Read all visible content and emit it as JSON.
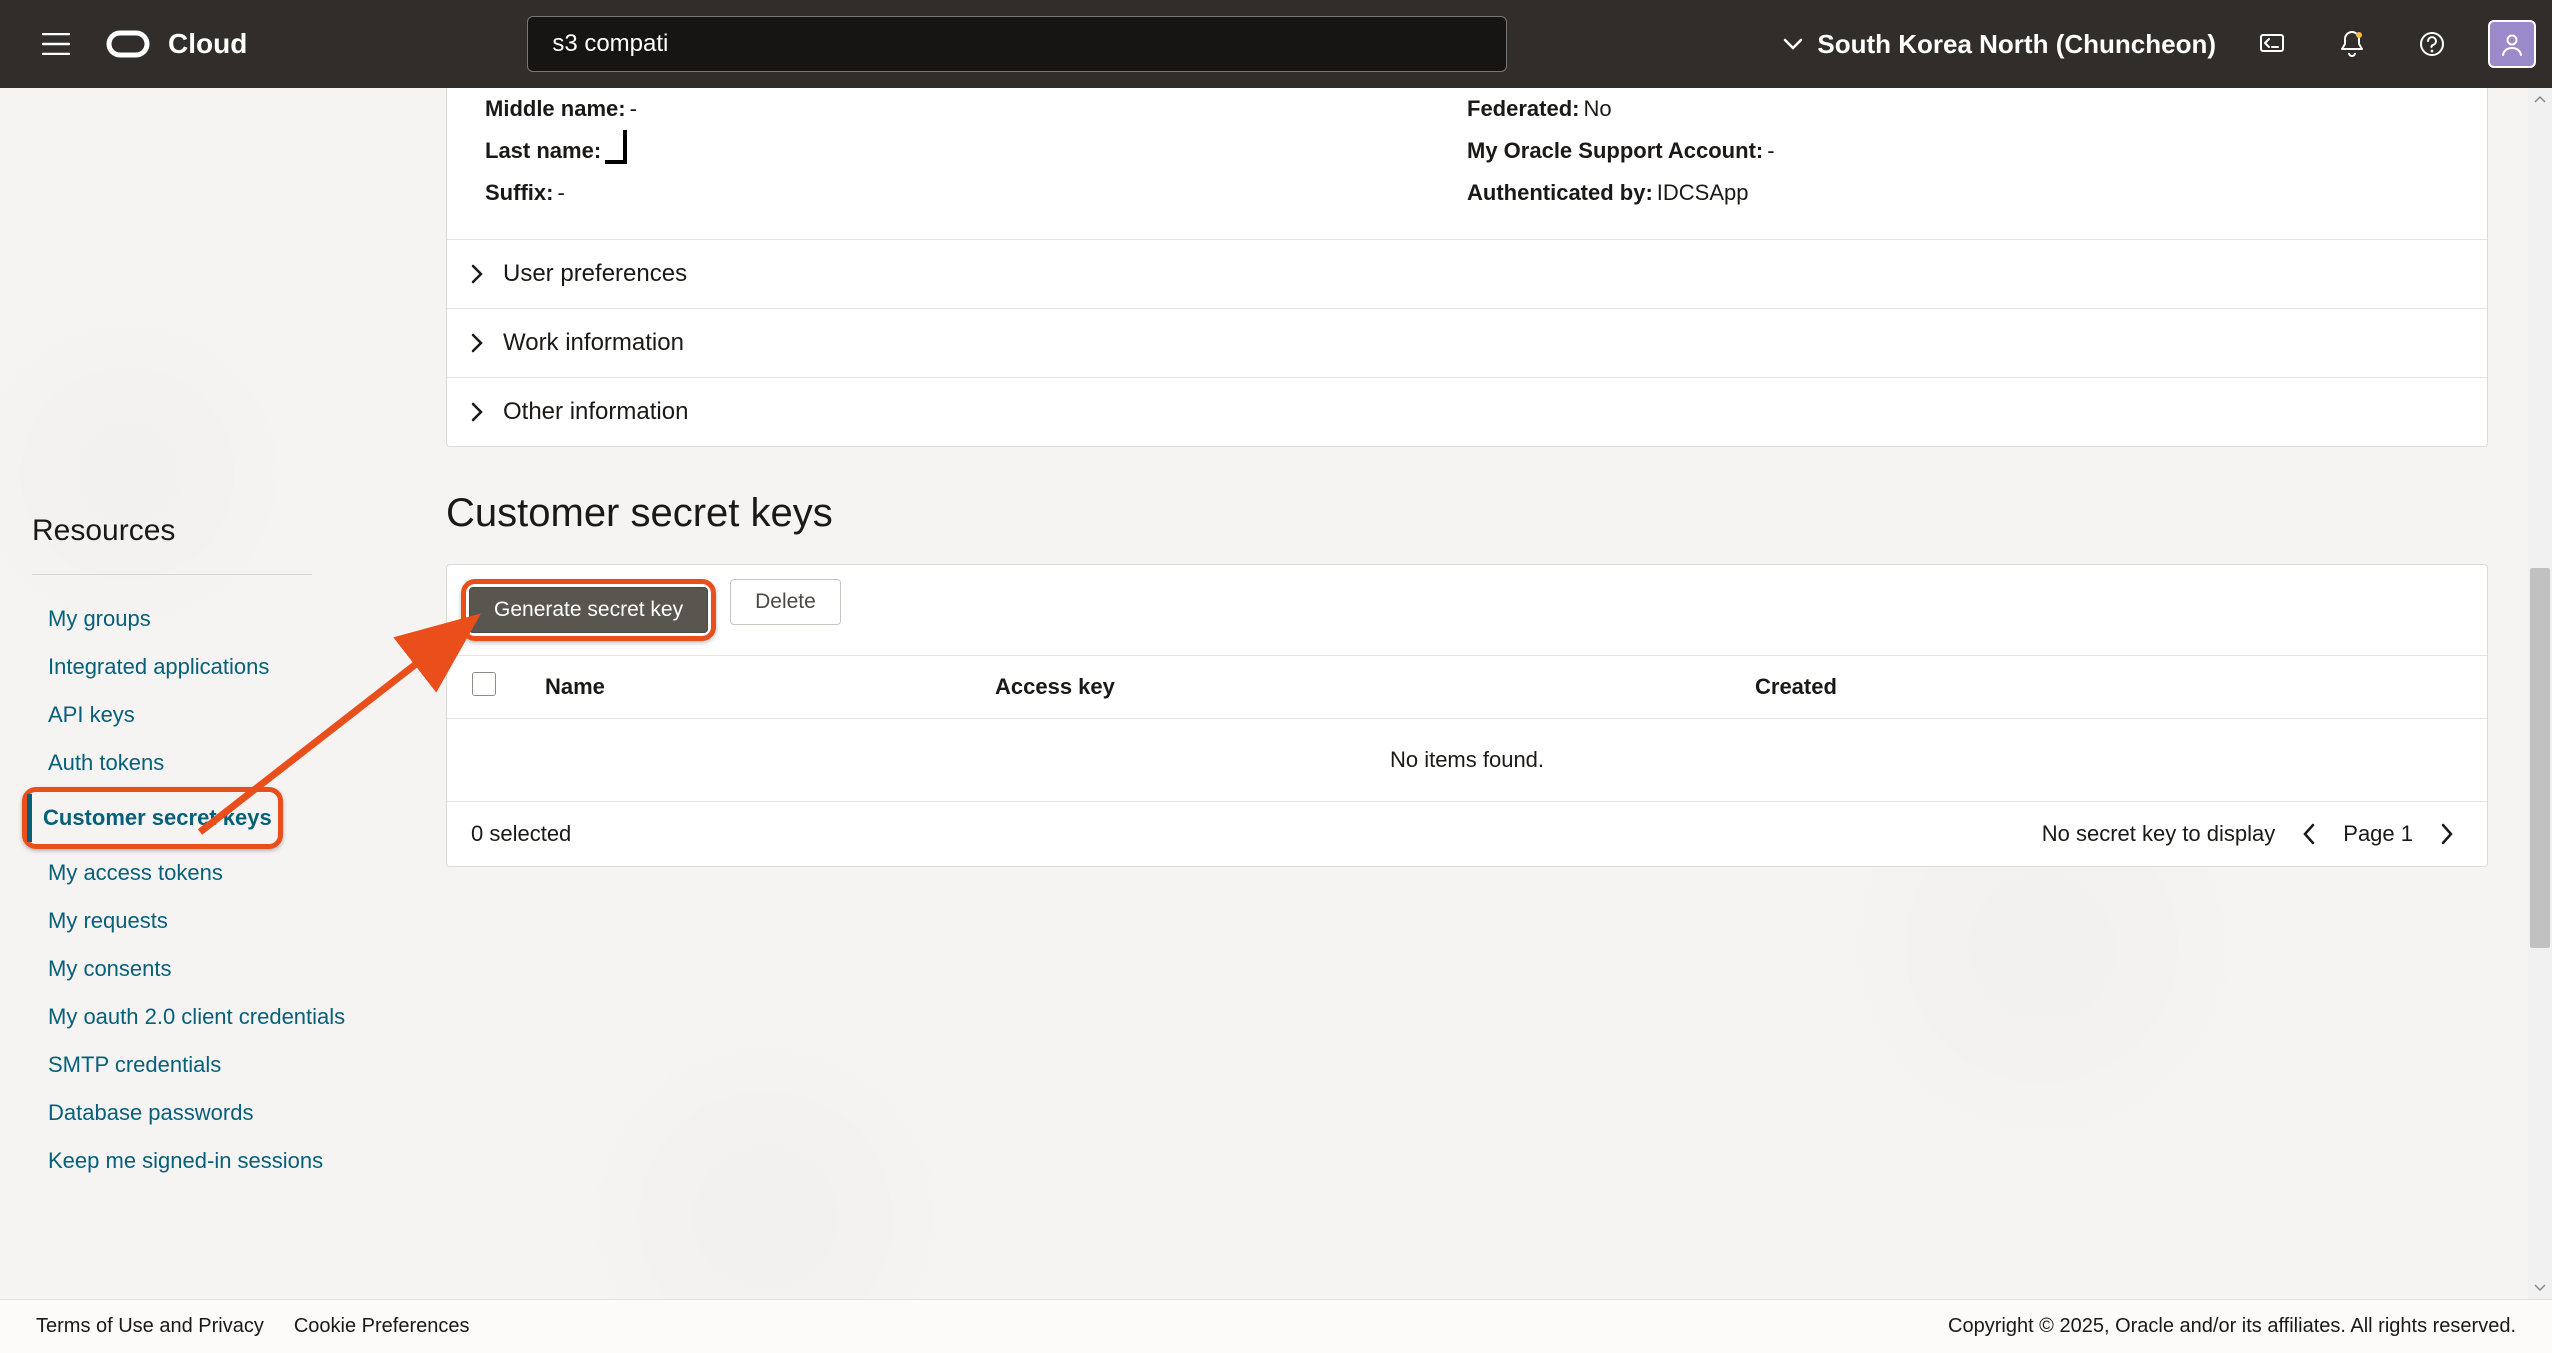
{
  "header": {
    "brand": "Cloud",
    "search_value": "s3 compati",
    "region": "South Korea North (Chuncheon)"
  },
  "details": {
    "left": [
      {
        "label": "Middle name:",
        "value": "-"
      },
      {
        "label": "Last name:",
        "value": ""
      },
      {
        "label": "Suffix:",
        "value": "-"
      }
    ],
    "right": [
      {
        "label": "Federated:",
        "value": "No"
      },
      {
        "label": "My Oracle Support Account:",
        "value": "-"
      },
      {
        "label": "Authenticated by:",
        "value": "IDCSApp"
      }
    ],
    "accordions": [
      "User preferences",
      "Work information",
      "Other information"
    ]
  },
  "sidebar": {
    "title": "Resources",
    "items": [
      "My groups",
      "Integrated applications",
      "API keys",
      "Auth tokens",
      "Customer secret keys",
      "My access tokens",
      "My requests",
      "My consents",
      "My oauth 2.0 client credentials",
      "SMTP credentials",
      "Database passwords",
      "Keep me signed-in sessions"
    ],
    "active_index": 4
  },
  "section_title": "Customer secret keys",
  "table": {
    "generate_label": "Generate secret key",
    "delete_label": "Delete",
    "cols": [
      "Name",
      "Access key",
      "Created"
    ],
    "empty": "No items found.",
    "selected_text": "0 selected",
    "pager_msg": "No secret key to display",
    "pager_page": "Page 1"
  },
  "footer": {
    "terms": "Terms of Use and Privacy",
    "cookies": "Cookie Preferences",
    "copyright": "Copyright © 2025, Oracle and/or its affiliates. All rights reserved."
  }
}
